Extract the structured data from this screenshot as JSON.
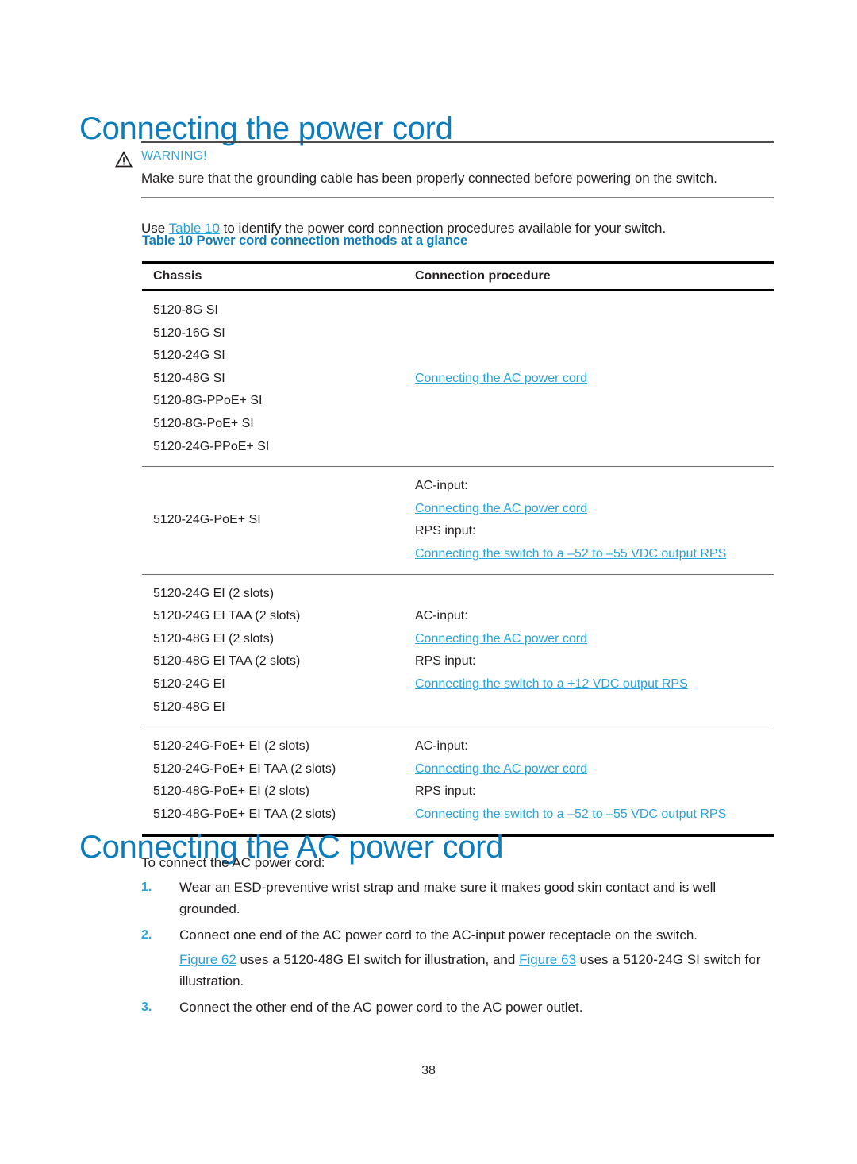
{
  "document": {
    "page_title": "Connecting the power cord",
    "page_number": "38"
  },
  "warning": {
    "icon": "warning-triangle-icon",
    "label": "WARNING!",
    "text": "Make sure that the grounding cable has been properly connected before powering on the switch.",
    "label_color": "#29a3dc"
  },
  "intro": {
    "before_link": "Use ",
    "link": "Table 10",
    "after_link": " to identify the power cord connection procedures available for your switch."
  },
  "table": {
    "caption": "Table 10 Power cord connection methods at a glance",
    "headers": [
      "Chassis",
      "Connection procedure"
    ],
    "rows": [
      {
        "chassis": [
          "5120-8G SI",
          "5120-16G SI",
          "5120-24G SI",
          "5120-48G SI",
          "5120-8G-PPoE+ SI",
          "5120-8G-PoE+ SI",
          "5120-24G-PPoE+ SI"
        ],
        "procedure": [
          {
            "text": "Connecting the AC power cord",
            "link": true
          }
        ]
      },
      {
        "chassis": [
          "5120-24G-PoE+ SI"
        ],
        "procedure": [
          {
            "text": "AC-input:",
            "link": false
          },
          {
            "text": "Connecting the AC power cord",
            "link": true
          },
          {
            "text": "RPS input:",
            "link": false
          },
          {
            "text": "Connecting the switch to a –52 to –55 VDC output RPS",
            "link": true
          }
        ]
      },
      {
        "chassis": [
          "5120-24G EI (2 slots)",
          "5120-24G EI TAA (2 slots)",
          "5120-48G EI (2 slots)",
          "5120-48G EI TAA (2 slots)",
          "5120-24G EI",
          "5120-48G EI"
        ],
        "procedure": [
          {
            "text": "AC-input:",
            "link": false
          },
          {
            "text": "Connecting the AC power cord",
            "link": true
          },
          {
            "text": "RPS input:",
            "link": false
          },
          {
            "text": "Connecting the switch to a +12 VDC output RPS",
            "link": true
          }
        ]
      },
      {
        "chassis": [
          "5120-24G-PoE+ EI (2 slots)",
          "5120-24G-PoE+ EI TAA (2 slots)",
          "5120-48G-PoE+ EI (2 slots)",
          "5120-48G-PoE+ EI TAA (2 slots)"
        ],
        "procedure": [
          {
            "text": "AC-input:",
            "link": false
          },
          {
            "text": "Connecting the AC power cord",
            "link": true
          },
          {
            "text": "RPS input:",
            "link": false
          },
          {
            "text": "Connecting the switch to a –52 to –55 VDC output RPS",
            "link": true
          }
        ]
      }
    ]
  },
  "section_ac": {
    "heading": "Connecting the AC power cord",
    "intro": "To connect the AC power cord:",
    "steps": [
      {
        "num": "1.",
        "text": "Wear an ESD-preventive wrist strap and make sure it makes good skin contact and is well grounded.",
        "sub": null
      },
      {
        "num": "2.",
        "text": "Connect one end of the AC power cord to the AC-input power receptacle on the switch.",
        "sub": {
          "link1": "Figure 62",
          "mid1": " uses a 5120-48G EI switch for illustration, and ",
          "link2": "Figure 63",
          "mid2": " uses a 5120-24G SI switch for illustration."
        }
      },
      {
        "num": "3.",
        "text": "Connect the other end of the AC power cord to the AC power outlet.",
        "sub": null
      }
    ]
  },
  "colors": {
    "heading_blue": "#0d7cbd",
    "link_blue": "#29a3dc",
    "body_black": "#231f20"
  }
}
